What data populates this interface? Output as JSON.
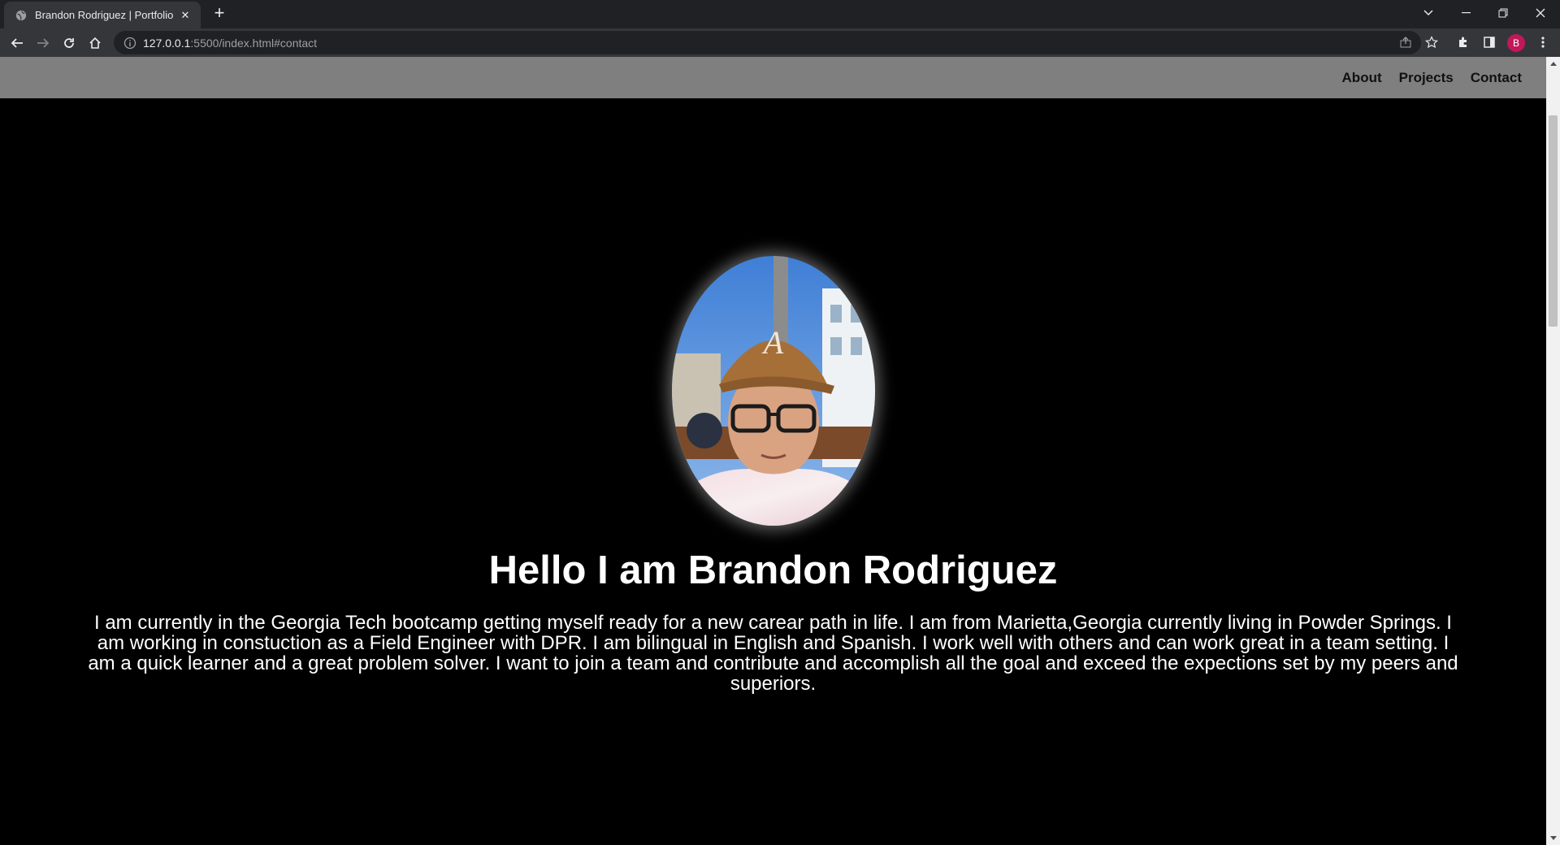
{
  "browser": {
    "tab_title": "Brandon Rodriguez | Portfolio",
    "url_host": "127.0.0.1",
    "url_rest": ":5500/index.html#contact",
    "profile_initial": "B"
  },
  "nav": {
    "items": [
      {
        "label": "About"
      },
      {
        "label": "Projects"
      },
      {
        "label": "Contact"
      }
    ]
  },
  "hero": {
    "heading": "Hello I am Brandon Rodriguez",
    "bio": "I am currently in the Georgia Tech bootcamp getting myself ready for a new carear path in life. I am from Marietta,Georgia currently living in Powder Springs. I am working in constuction as a Field Engineer with DPR. I am bilingual in English and Spanish. I work well with others and can work great in a team setting. I am a quick learner and a great problem solver. I want to join a team and contribute and accomplish all the goal and exceed the expections set by my peers and superiors."
  },
  "colors": {
    "header_bg": "#7f7f7f",
    "page_bg": "#000000",
    "profile_badge": "#c2185b"
  }
}
